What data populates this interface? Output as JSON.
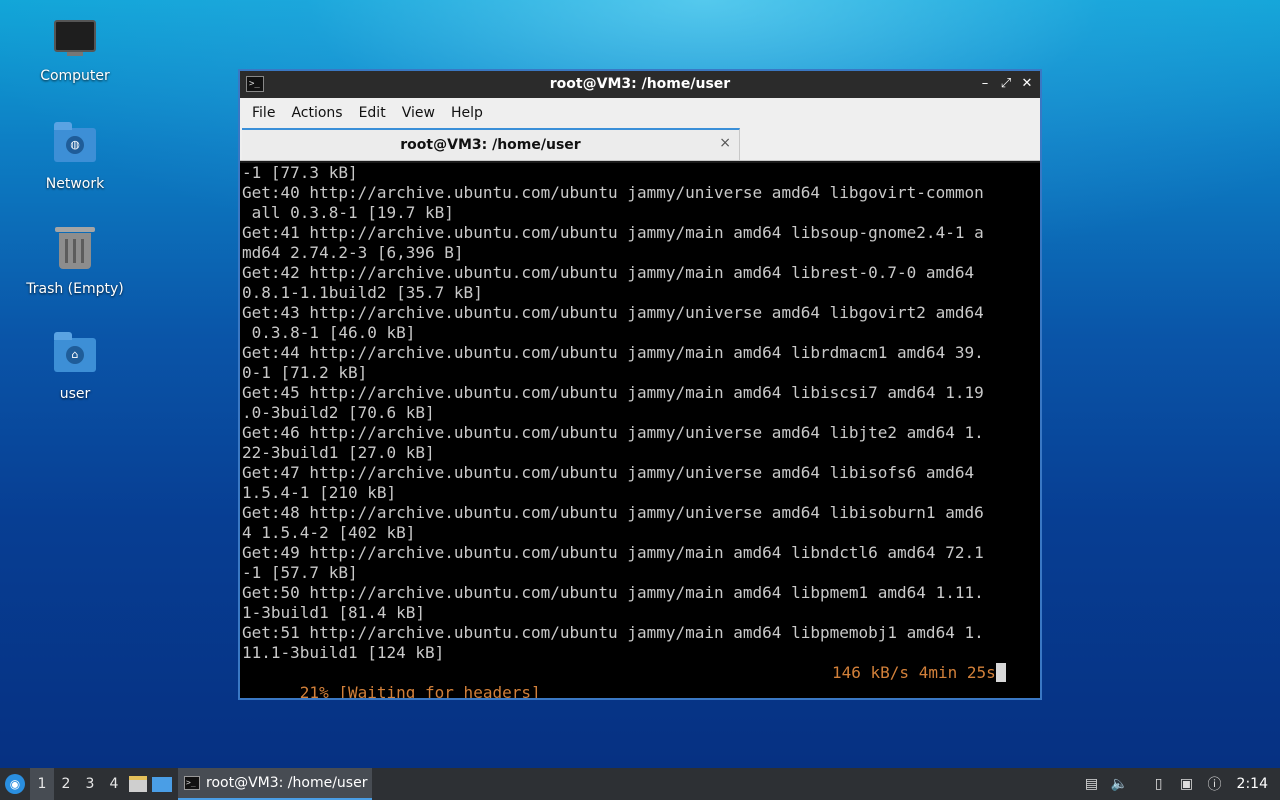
{
  "desktop": {
    "icons": [
      {
        "label": "Computer",
        "icon": "computer-icon"
      },
      {
        "label": "Network",
        "icon": "network-folder-icon"
      },
      {
        "label": "Trash (Empty)",
        "icon": "trash-icon"
      },
      {
        "label": "user",
        "icon": "home-folder-icon"
      }
    ]
  },
  "window": {
    "title": "root@VM3: /home/user",
    "menu": [
      "File",
      "Actions",
      "Edit",
      "View",
      "Help"
    ],
    "tab_label": "root@VM3: /home/user",
    "tab_close": "×",
    "lines": [
      "-1 [77.3 kB]",
      "Get:40 http://archive.ubuntu.com/ubuntu jammy/universe amd64 libgovirt-common",
      " all 0.3.8-1 [19.7 kB]",
      "Get:41 http://archive.ubuntu.com/ubuntu jammy/main amd64 libsoup-gnome2.4-1 a",
      "md64 2.74.2-3 [6,396 B]",
      "Get:42 http://archive.ubuntu.com/ubuntu jammy/main amd64 librest-0.7-0 amd64",
      "0.8.1-1.1build2 [35.7 kB]",
      "Get:43 http://archive.ubuntu.com/ubuntu jammy/universe amd64 libgovirt2 amd64",
      " 0.3.8-1 [46.0 kB]",
      "Get:44 http://archive.ubuntu.com/ubuntu jammy/main amd64 librdmacm1 amd64 39.",
      "0-1 [71.2 kB]",
      "Get:45 http://archive.ubuntu.com/ubuntu jammy/main amd64 libiscsi7 amd64 1.19",
      ".0-3build2 [70.6 kB]",
      "Get:46 http://archive.ubuntu.com/ubuntu jammy/universe amd64 libjte2 amd64 1.",
      "22-3build1 [27.0 kB]",
      "Get:47 http://archive.ubuntu.com/ubuntu jammy/universe amd64 libisofs6 amd64",
      "1.5.4-1 [210 kB]",
      "Get:48 http://archive.ubuntu.com/ubuntu jammy/universe amd64 libisoburn1 amd6",
      "4 1.5.4-2 [402 kB]",
      "Get:49 http://archive.ubuntu.com/ubuntu jammy/main amd64 libndctl6 amd64 72.1",
      "-1 [57.7 kB]",
      "Get:50 http://archive.ubuntu.com/ubuntu jammy/main amd64 libpmem1 amd64 1.11.",
      "1-3build1 [81.4 kB]",
      "Get:51 http://archive.ubuntu.com/ubuntu jammy/main amd64 libpmemobj1 amd64 1.",
      "11.1-3build1 [124 kB]"
    ],
    "status_left": "21% [Waiting for headers]",
    "status_right": "146 kB/s 4min 25s"
  },
  "taskbar": {
    "workspaces": [
      "1",
      "2",
      "3",
      "4"
    ],
    "active_workspace": "1",
    "task_label": "root@VM3: /home/user",
    "clock": "2:14"
  },
  "colors": {
    "accent": "#3a8fd8",
    "status_text": "#d2803a",
    "terminal_bg": "#000000"
  }
}
